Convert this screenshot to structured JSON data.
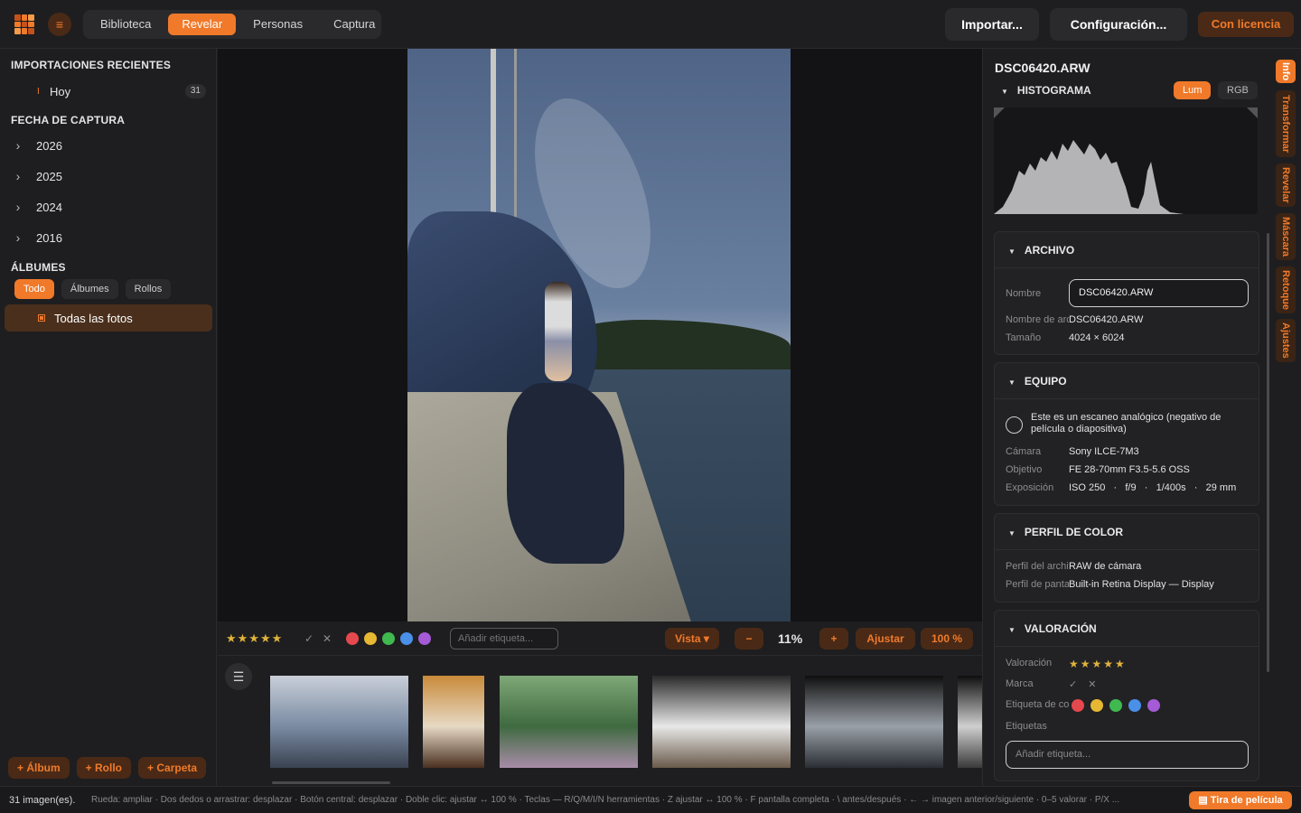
{
  "topbar": {
    "menu_icon": "≡",
    "tabs": [
      {
        "label": "Biblioteca",
        "active": false
      },
      {
        "label": "Revelar",
        "active": true
      },
      {
        "label": "Personas",
        "active": false
      },
      {
        "label": "Captura",
        "active": false
      }
    ],
    "import_label": "Importar...",
    "settings_label": "Configuración...",
    "license_label": "Con licencia"
  },
  "sidebar": {
    "recent_title": "IMPORTACIONES RECIENTES",
    "recent_items": [
      {
        "label": "Hoy",
        "count": "31",
        "icon": "I"
      }
    ],
    "date_title": "FECHA DE CAPTURA",
    "years": [
      "2026",
      "2025",
      "2024",
      "2016"
    ],
    "albums_title": "ÁLBUMES",
    "album_filters": [
      {
        "label": "Todo",
        "active": true
      },
      {
        "label": "Álbumes",
        "active": false
      },
      {
        "label": "Rollos",
        "active": false
      }
    ],
    "all_photos_label": "Todas las fotos",
    "bottom_buttons": [
      "+ Álbum",
      "+ Rollo",
      "+ Carpeta"
    ]
  },
  "toolbar": {
    "stars": "★★★★★",
    "flag_pick": "✓",
    "flag_reject": "✕",
    "color_labels": [
      "#e5484d",
      "#e6b833",
      "#3fb950",
      "#4a8fe8",
      "#a55ad6"
    ],
    "tag_placeholder": "Añadir etiqueta...",
    "view_label": "Vista ▾",
    "zoom_out": "−",
    "zoom_value": "11%",
    "zoom_in": "+",
    "fit_label": "Ajustar",
    "full_label": "100 %"
  },
  "filmstrip": {
    "toggle_icon": "☰",
    "thumbnails": [
      {
        "name": "city-sunset",
        "colors": [
          "#c9cfd8",
          "#7a8ba3",
          "#3a4250"
        ]
      },
      {
        "name": "woman-hat",
        "colors": [
          "#c98a3a",
          "#e6d9c4",
          "#4a3020"
        ]
      },
      {
        "name": "plant-berries",
        "colors": [
          "#7fa878",
          "#3f6a40",
          "#a88ca8"
        ]
      },
      {
        "name": "otter-snow",
        "colors": [
          "#2a2a2a",
          "#e8e8e8",
          "#6a5a4a"
        ]
      },
      {
        "name": "film-scan-bw",
        "colors": [
          "#0e0e0e",
          "#9aa0a8",
          "#2a2e34"
        ]
      },
      {
        "name": "film-scan-partial",
        "colors": [
          "#0e0e0e",
          "#cfcfcf",
          "#3a3a3a"
        ]
      }
    ]
  },
  "panel": {
    "filename": "DSC06420.ARW",
    "histogram_title": "HISTOGRAMA",
    "histogram_modes": [
      {
        "label": "Lum",
        "active": true
      },
      {
        "label": "RGB",
        "active": false
      }
    ],
    "archivo": {
      "title": "ARCHIVO",
      "name_label": "Nombre",
      "name_value": "DSC06420.ARW",
      "orig_label": "Nombre de archivo",
      "orig_value": "DSC06420.ARW",
      "size_label": "Tamaño",
      "size_value": "4024 × 6024"
    },
    "equipo": {
      "title": "EQUIPO",
      "scan_text": "Este es un escaneo analógico (negativo de película o diapositiva)",
      "camera_label": "Cámara",
      "camera_value": "Sony ILCE-7M3",
      "lens_label": "Objetivo",
      "lens_value": "FE 28-70mm F3.5-5.6 OSS",
      "exposure_label": "Exposición",
      "exposure_value": "ISO 250   ·   f/9   ·   1/400s   ·   29 mm"
    },
    "perfil": {
      "title": "PERFIL DE COLOR",
      "file_label": "Perfil del archivo",
      "file_value": "RAW de cámara",
      "screen_label": "Perfil de pantalla",
      "screen_value": "Built-in Retina Display — Display"
    },
    "valoracion": {
      "title": "VALORACIÓN",
      "rating_label": "Valoración",
      "rating_stars": "★★★★★",
      "flag_label": "Marca",
      "flag_pick": "✓",
      "flag_reject": "✕",
      "color_label": "Etiqueta de color",
      "colors": [
        "#e5484d",
        "#e6b833",
        "#3fb950",
        "#4a8fe8",
        "#a55ad6"
      ],
      "tags_label": "Etiquetas",
      "tags_placeholder": "Añadir etiqueta..."
    }
  },
  "vtabs": [
    {
      "label": "Info",
      "active": true
    },
    {
      "label": "Transformar",
      "active": false
    },
    {
      "label": "Revelar",
      "active": false
    },
    {
      "label": "Máscara",
      "active": false
    },
    {
      "label": "Retoque",
      "active": false
    },
    {
      "label": "Ajustes",
      "active": false
    }
  ],
  "status": {
    "count": "31 imagen(es).",
    "hint": "Rueda: ampliar · Dos dedos o arrastrar: desplazar · Botón central: desplazar · Doble clic: ajustar ↔ 100 %   ·   Teclas — R/Q/M/I/N herramientas · Z ajustar ↔ 100 % · F pantalla completa · \\ antes/después · ← → imagen anterior/siguiente · 0–5 valorar · P/X ...",
    "filmstrip_button": "▤ Tira de película"
  }
}
